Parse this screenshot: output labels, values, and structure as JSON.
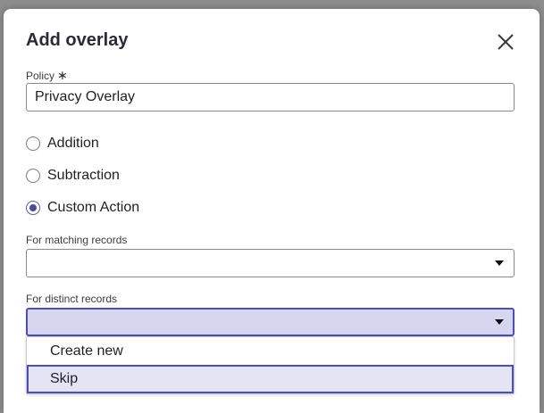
{
  "modal": {
    "title": "Add overlay",
    "close_label": "close"
  },
  "policy": {
    "label": "Policy",
    "required_mark": "∗",
    "value": "Privacy Overlay"
  },
  "radios": [
    {
      "label": "Addition",
      "checked": false
    },
    {
      "label": "Subtraction",
      "checked": false
    },
    {
      "label": "Custom Action",
      "checked": true
    }
  ],
  "matching": {
    "label": "For matching records",
    "value": ""
  },
  "distinct": {
    "label": "For distinct records",
    "value": "",
    "options": [
      {
        "label": "Create new",
        "selected": false
      },
      {
        "label": "Skip",
        "selected": true
      }
    ]
  },
  "colors": {
    "accent": "#4d4dbd",
    "focus_fill": "#d6d6ee"
  }
}
